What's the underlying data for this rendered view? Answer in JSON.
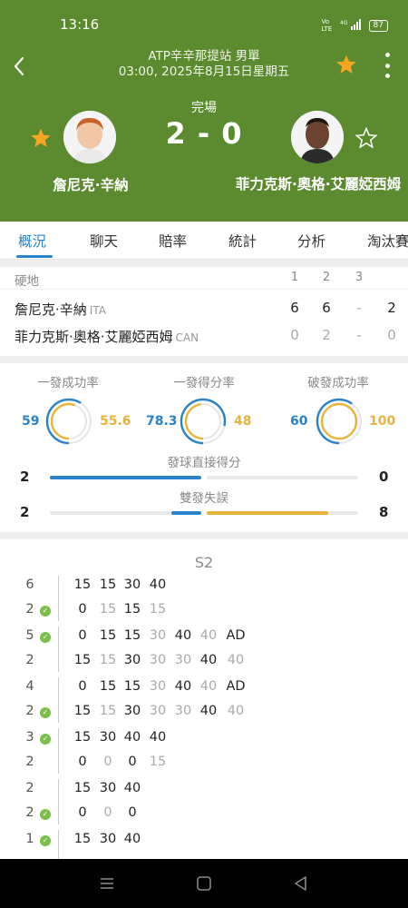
{
  "status_bar": {
    "time": "13:16",
    "net1": "Vo LTE",
    "net2": "4G",
    "battery": "87"
  },
  "header": {
    "tournament": "ATP辛辛那提站 男單",
    "datetime": "03:00, 2025年8月15日星期五",
    "status": "完場",
    "score": "2 - 0",
    "player1": {
      "name": "詹尼克·辛納",
      "favorite": true
    },
    "player2": {
      "name": "菲力克斯·奧格·艾麗婭西姆",
      "favorite": false
    }
  },
  "tabs": [
    {
      "label": "概況",
      "active": true
    },
    {
      "label": "聊天",
      "active": false
    },
    {
      "label": "賠率",
      "active": false
    },
    {
      "label": "統計",
      "active": false
    },
    {
      "label": "分析",
      "active": false
    },
    {
      "label": "淘汰賽",
      "active": false
    }
  ],
  "sets": {
    "surface": "硬地",
    "columns": [
      "1",
      "2",
      "3"
    ],
    "rows": [
      {
        "name": "詹尼克·辛納",
        "country": "ITA",
        "s1": "6",
        "s2": "6",
        "s3": "-",
        "total": "2"
      },
      {
        "name": "菲力克斯·奧格·艾麗婭西姆",
        "country": "CAN",
        "s1": "0",
        "s2": "2",
        "s3": "-",
        "total": "0"
      }
    ]
  },
  "stats": {
    "donuts": [
      {
        "title": "一發成功率",
        "left": "59",
        "right": "55.6",
        "left_pct": 59,
        "right_pct": 55.6
      },
      {
        "title": "一發得分率",
        "left": "78.3",
        "right": "48",
        "left_pct": 78.3,
        "right_pct": 48
      },
      {
        "title": "破發成功率",
        "left": "60",
        "right": "100",
        "left_pct": 60,
        "right_pct": 100
      }
    ],
    "bars": [
      {
        "title": "發球直接得分",
        "left": "2",
        "right": "0",
        "left_frac": 1.0,
        "right_frac": 0.0
      },
      {
        "title": "雙發失誤",
        "left": "2",
        "right": "8",
        "left_frac": 0.2,
        "right_frac": 0.8
      }
    ]
  },
  "colors": {
    "header": "#5b8a2f",
    "blue": "#2a83c8",
    "gold": "#e8b33a",
    "check": "#7bc04b",
    "star": "#f5a623"
  },
  "point_by_point": {
    "set_label": "S2",
    "games": [
      {
        "top_num": "6",
        "top_check": false,
        "top_points": [
          "15",
          "15",
          "30",
          "40"
        ],
        "bottom_num": "2",
        "bottom_check": true,
        "bottom_points": [
          "0",
          "15",
          "15",
          "15"
        ]
      },
      {
        "top_num": "5",
        "top_check": true,
        "top_points": [
          "0",
          "15",
          "15",
          "30",
          "40",
          "40",
          "AD"
        ],
        "bottom_num": "2",
        "bottom_check": false,
        "bottom_points": [
          "15",
          "15",
          "30",
          "30",
          "30",
          "40",
          "40"
        ]
      },
      {
        "top_num": "4",
        "top_check": false,
        "top_points": [
          "0",
          "15",
          "15",
          "30",
          "40",
          "40",
          "AD"
        ],
        "bottom_num": "2",
        "bottom_check": true,
        "bottom_points": [
          "15",
          "15",
          "30",
          "30",
          "30",
          "40",
          "40"
        ]
      },
      {
        "top_num": "3",
        "top_check": true,
        "top_points": [
          "15",
          "30",
          "40",
          "40"
        ],
        "bottom_num": "2",
        "bottom_check": false,
        "bottom_points": [
          "0",
          "0",
          "0",
          "15"
        ]
      },
      {
        "top_num": "2",
        "top_check": false,
        "top_points": [
          "15",
          "30",
          "40"
        ],
        "bottom_num": "2",
        "bottom_check": true,
        "bottom_points": [
          "0",
          "0",
          "0"
        ]
      },
      {
        "top_num": "1",
        "top_check": true,
        "top_points": [
          "15",
          "30",
          "40"
        ],
        "bottom_num": "",
        "bottom_check": false,
        "bottom_points": []
      }
    ]
  },
  "nav": {
    "icons": [
      "menu-icon",
      "home-icon",
      "back-icon"
    ]
  }
}
